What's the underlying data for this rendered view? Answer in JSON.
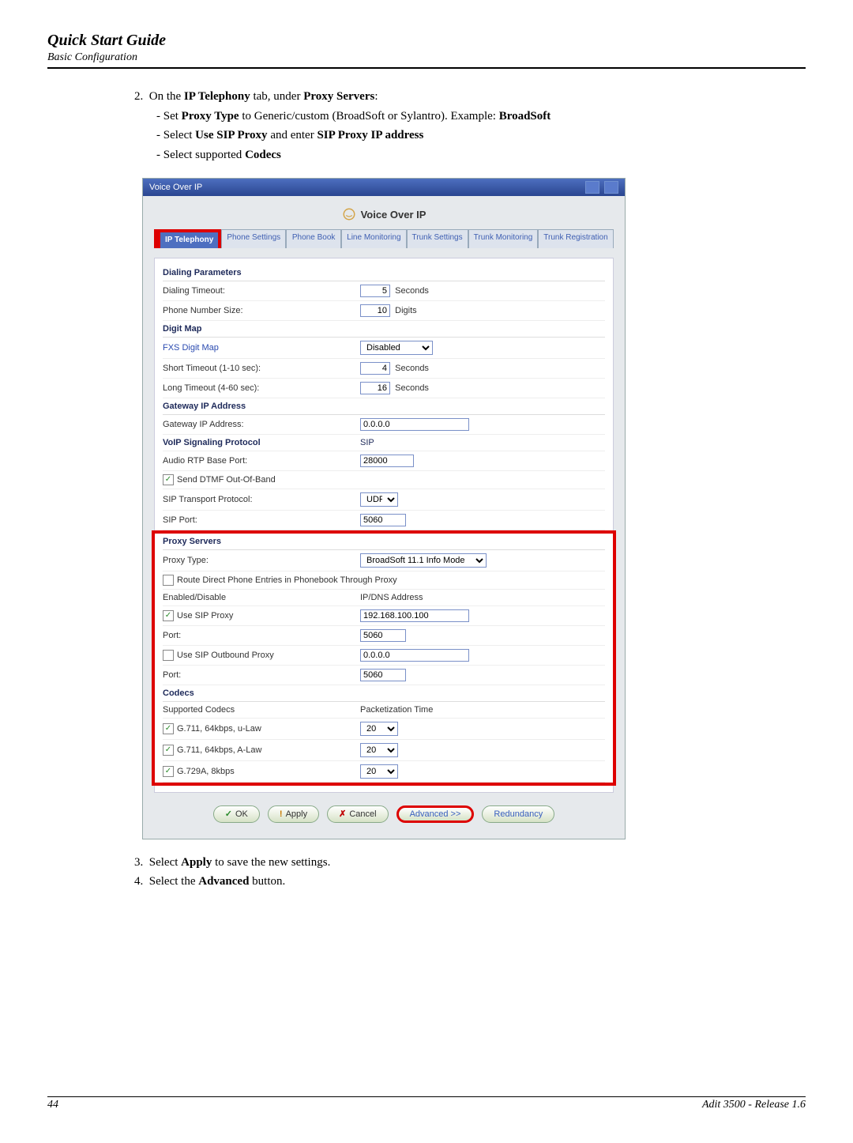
{
  "header": {
    "title": "Quick Start Guide",
    "subtitle": "Basic Configuration"
  },
  "steps": {
    "s2": {
      "lead": "On the ",
      "b1": "IP Telephony",
      "mid": " tab, under ",
      "b2": "Proxy Servers",
      "tail": ":",
      "sub1a": "Set ",
      "sub1b": "Proxy Type",
      "sub1c": " to Generic/custom (BroadSoft or Sylantro). Example: ",
      "sub1d": "BroadSoft",
      "sub2a": "Select ",
      "sub2b": "Use SIP Proxy",
      "sub2c": " and enter ",
      "sub2d": "SIP Proxy IP address",
      "sub3a": "Select supported ",
      "sub3b": "Codecs"
    },
    "s3": {
      "a": "Select ",
      "b": "Apply",
      "c": " to save the new settings."
    },
    "s4": {
      "a": "Select the ",
      "b": "Advanced",
      "c": " button."
    }
  },
  "panel": {
    "titlebar": "Voice Over IP",
    "page_title": "Voice Over IP",
    "tabs": [
      "IP Telephony",
      "Phone Settings",
      "Phone Book",
      "Line Monitoring",
      "Trunk Settings",
      "Trunk Monitoring",
      "Trunk Registration"
    ],
    "sections": {
      "dialing": "Dialing Parameters",
      "digitmap": "Digit Map",
      "gateway": "Gateway IP Address",
      "voipsig": "VoIP Signaling Protocol",
      "voipsig_val": "SIP",
      "proxy": "Proxy Servers",
      "codecs": "Codecs"
    },
    "labels": {
      "dial_timeout": "Dialing Timeout:",
      "phone_size": "Phone Number Size:",
      "fxs": "FXS Digit Map",
      "short_to": "Short Timeout (1-10 sec):",
      "long_to": "Long Timeout (4-60 sec):",
      "gw_ip": "Gateway IP Address:",
      "rtp_base": "Audio RTP Base Port:",
      "dtmf": "Send DTMF Out-Of-Band",
      "sip_xport": "SIP Transport Protocol:",
      "sip_port": "SIP Port:",
      "proxy_type": "Proxy Type:",
      "route_direct": "Route Direct Phone Entries in Phonebook Through Proxy",
      "enable_col": "Enabled/Disable",
      "ipdns_col": "IP/DNS Address",
      "use_sip": "Use SIP Proxy",
      "port1": "Port:",
      "use_outbound": "Use SIP Outbound Proxy",
      "port2": "Port:",
      "supported": "Supported Codecs",
      "pkt_time": "Packetization Time",
      "c1": "G.711, 64kbps, u-Law",
      "c2": "G.711, 64kbps, A-Law",
      "c3": "G.729A, 8kbps"
    },
    "vals": {
      "dial_timeout": "5",
      "dial_timeout_unit": "Seconds",
      "phone_size": "10",
      "phone_size_unit": "Digits",
      "fxs": "Disabled",
      "short_to": "4",
      "short_unit": "Seconds",
      "long_to": "16",
      "long_unit": "Seconds",
      "gw_ip": "0.0.0.0",
      "rtp_base": "28000",
      "sip_xport": "UDP",
      "sip_port": "5060",
      "proxy_type": "BroadSoft 11.1 Info Mode",
      "sip_ip": "192.168.100.100",
      "port1": "5060",
      "outbound_ip": "0.0.0.0",
      "port2": "5060",
      "pt1": "20",
      "pt2": "20",
      "pt3": "20"
    },
    "buttons": {
      "ok": "OK",
      "apply": "Apply",
      "cancel": "Cancel",
      "advanced": "Advanced >>",
      "redundancy": "Redundancy"
    }
  },
  "footer": {
    "page": "44",
    "product": "Adit 3500  - Release 1.6"
  }
}
